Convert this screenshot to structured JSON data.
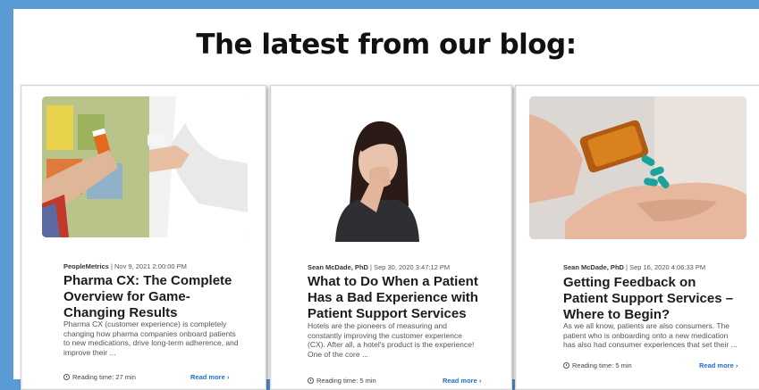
{
  "heading": "The latest from our blog:",
  "cards": [
    {
      "author": "PeopleMetrics",
      "date": "Nov 9, 2021 2:00:00 PM",
      "title": "Pharma CX: The Complete Overview for Game-Changing Results",
      "excerpt": "Pharma CX (customer experience) is completely changing how pharma companies onboard patients to new medications, drive long-term adherence, and improve their ...",
      "reading_time": "Reading time: 27 min",
      "read_more": "Read more ›"
    },
    {
      "author": "Sean McDade, PhD",
      "date": "Sep 30, 2020 3:47:12 PM",
      "title": "What to Do When a Patient Has a Bad Experience with Patient Support Services",
      "excerpt": "Hotels are the pioneers of measuring and constantly improving the customer experience (CX). After all, a hotel's product is the experience! One of the core ...",
      "reading_time": "Reading time: 5 min",
      "read_more": "Read more ›"
    },
    {
      "author": "Sean McDade, PhD",
      "date": "Sep 16, 2020 4:06:33 PM",
      "title": "Getting Feedback on Patient Support Services – Where to Begin?",
      "excerpt": "As we all know, patients are also consumers. The patient who is onboarding onto a new medication has also had consumer experiences that set their ...",
      "reading_time": "Reading time: 5 min",
      "read_more": "Read more ›"
    }
  ]
}
